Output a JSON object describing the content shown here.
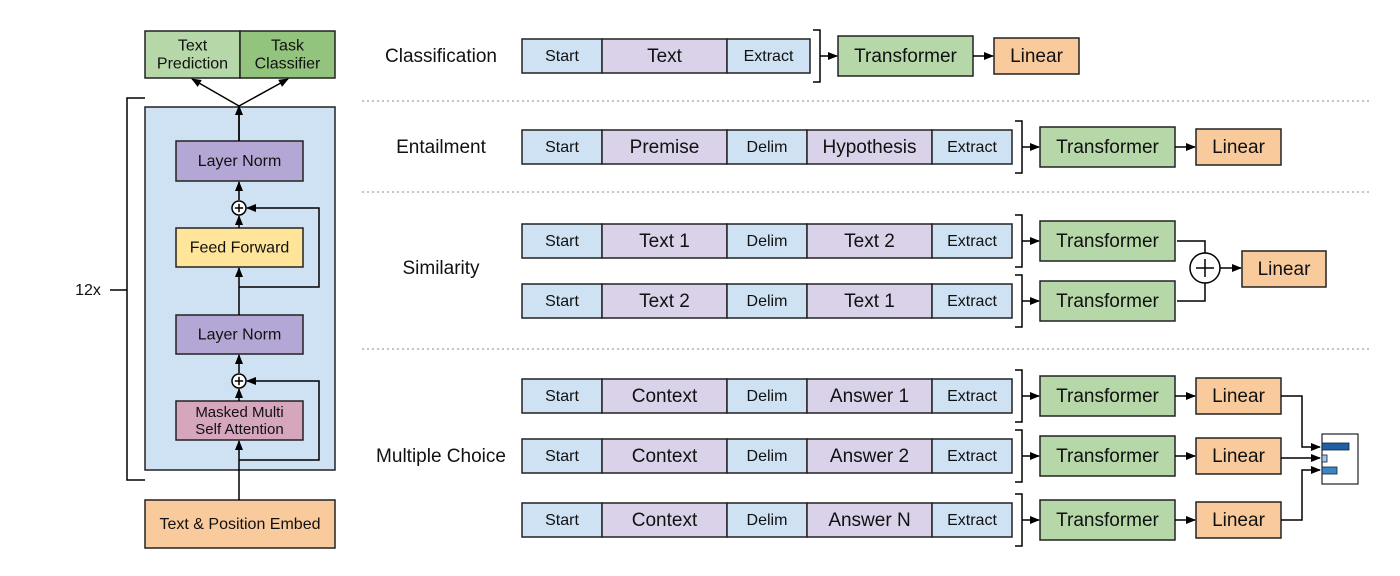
{
  "colors": {
    "token_light": "#cfe2f3",
    "token_content": "#d9d2e9",
    "transformer": "#b6d7a8",
    "linear": "#f9cb9c",
    "block_bg": "#cfe2f3",
    "layer_norm": "#b4a7d6",
    "feed_forward": "#ffe599",
    "attention": "#d5a6bd",
    "embed": "#f9cb9c",
    "text_prediction": "#b6d7a8",
    "task_classifier": "#93c47d",
    "bar_dark": "#1f5fa6",
    "bar_mid": "#3d85c6",
    "bar_light": "#9fc5e8"
  },
  "architecture": {
    "heads": [
      "Text\nPrediction",
      "Task\nClassifier"
    ],
    "layer_norm_top": "Layer Norm",
    "feed_forward": "Feed Forward",
    "layer_norm_bottom": "Layer Norm",
    "attention": "Masked Multi\nSelf Attention",
    "embed": "Text & Position Embed",
    "repeat": "12x"
  },
  "tasks": [
    {
      "label": "Classification",
      "rows": [
        [
          "Start",
          "Text",
          "Extract"
        ]
      ],
      "transformer": "Transformer",
      "linear": "Linear"
    },
    {
      "label": "Entailment",
      "rows": [
        [
          "Start",
          "Premise",
          "Delim",
          "Hypothesis",
          "Extract"
        ]
      ],
      "transformer": "Transformer",
      "linear": "Linear"
    },
    {
      "label": "Similarity",
      "rows": [
        [
          "Start",
          "Text 1",
          "Delim",
          "Text 2",
          "Extract"
        ],
        [
          "Start",
          "Text 2",
          "Delim",
          "Text 1",
          "Extract"
        ]
      ],
      "transformer": "Transformer",
      "linear": "Linear"
    },
    {
      "label": "Multiple Choice",
      "rows": [
        [
          "Start",
          "Context",
          "Delim",
          "Answer 1",
          "Extract"
        ],
        [
          "Start",
          "Context",
          "Delim",
          "Answer 2",
          "Extract"
        ],
        [
          "Start",
          "Context",
          "Delim",
          "Answer N",
          "Extract"
        ]
      ],
      "transformer": "Transformer",
      "linear": "Linear"
    }
  ]
}
